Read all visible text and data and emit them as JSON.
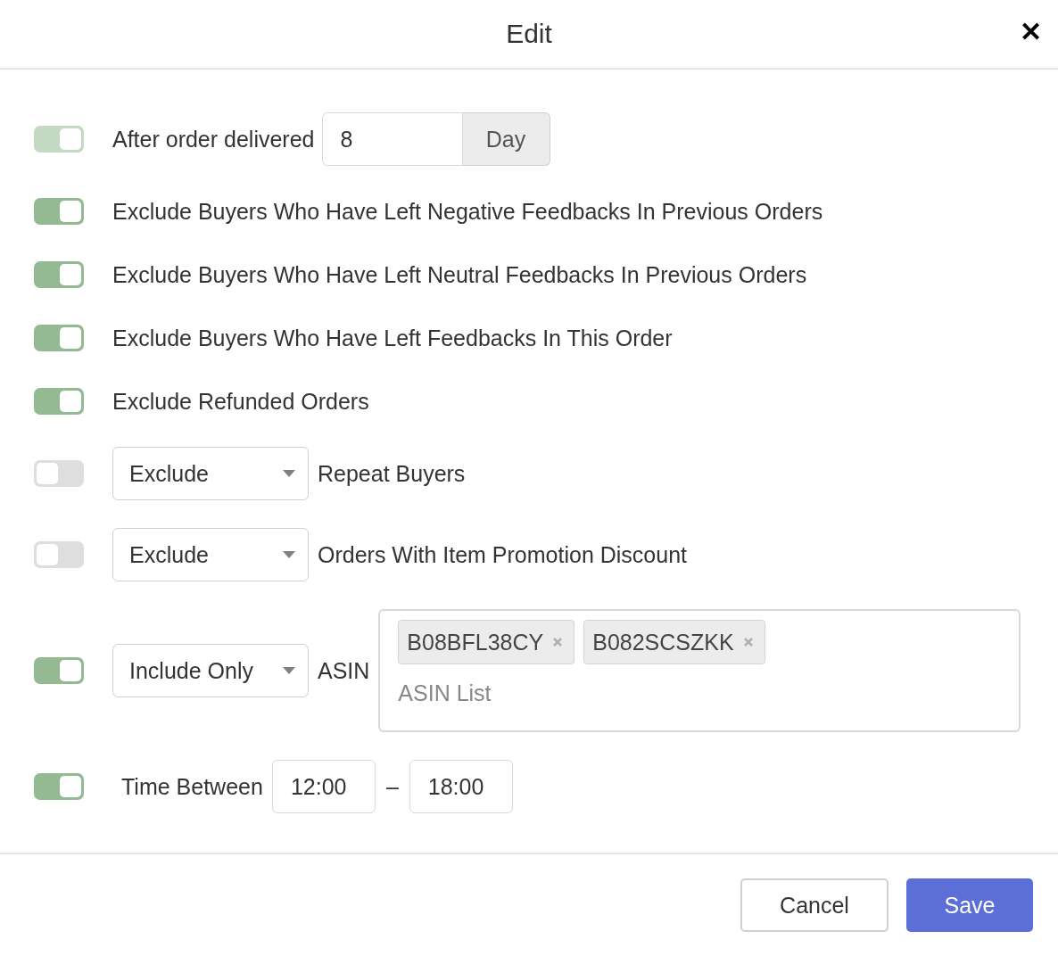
{
  "dialog": {
    "title": "Edit",
    "close": "✕"
  },
  "rules": [
    {
      "kind": "number",
      "on": true,
      "disabled": true,
      "label": "After order delivered",
      "value": "8",
      "unit": "Day"
    },
    {
      "kind": "text",
      "on": true,
      "disabled": false,
      "label": "Exclude Buyers Who Have Left Negative Feedbacks In Previous Orders"
    },
    {
      "kind": "text",
      "on": true,
      "disabled": false,
      "label": "Exclude Buyers Who Have Left Neutral Feedbacks In Previous Orders"
    },
    {
      "kind": "text",
      "on": true,
      "disabled": false,
      "label": "Exclude Buyers Who Have Left Feedbacks In This Order"
    },
    {
      "kind": "text",
      "on": true,
      "disabled": false,
      "label": "Exclude Refunded Orders"
    },
    {
      "kind": "select",
      "on": false,
      "disabled": false,
      "select": "Exclude",
      "label": "Repeat Buyers"
    },
    {
      "kind": "select",
      "on": false,
      "disabled": false,
      "select": "Exclude",
      "label": "Orders With Item Promotion Discount"
    },
    {
      "kind": "asin",
      "on": true,
      "disabled": false,
      "select": "Include Only",
      "label": "ASIN",
      "tags": [
        "B08BFL38CY",
        "B082SCSZKK"
      ],
      "placeholder": "ASIN List"
    },
    {
      "kind": "time",
      "on": true,
      "disabled": false,
      "label": "Time Between",
      "from": "12:00",
      "separator": "–",
      "to": "18:00"
    }
  ],
  "footer": {
    "cancel": "Cancel",
    "save": "Save"
  }
}
